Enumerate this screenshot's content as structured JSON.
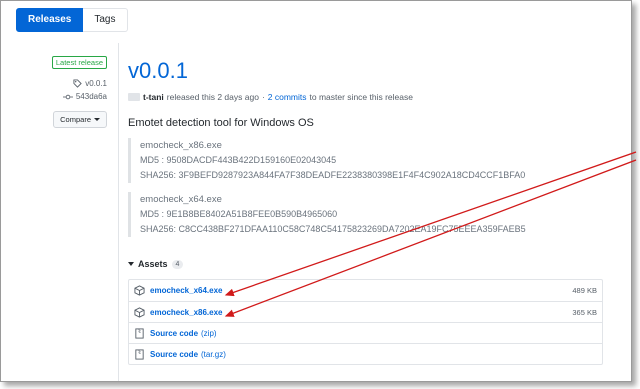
{
  "tabs": {
    "releases": "Releases",
    "tags": "Tags"
  },
  "sidebar": {
    "badge": "Latest release",
    "tag": "v0.0.1",
    "commit": "543da6a",
    "compare": "Compare"
  },
  "release": {
    "title": "v0.0.1",
    "author": "t-tani",
    "released": "released this 2 days ago",
    "separator": "·",
    "commits_link": "2 commits",
    "commits_suffix": "to master since this release",
    "description": "Emotet detection tool for Windows OS",
    "files": [
      {
        "name": "emocheck_x86.exe",
        "md5": "MD5 : 9508DACDF443B422D159160E02043045",
        "sha256": "SHA256: 3F9BEFD9287923A844FA7F38DEADFE2238380398E1F4F4C902A18CD4CCF1BFA0"
      },
      {
        "name": "emocheck_x64.exe",
        "md5": "MD5 : 9E1B8BE8402A51B8FEE0B590B4965060",
        "sha256": "SHA256: C8CC438BF271DFAA110C58C748C54175823269DA7202EA19FC75EEEA359FAEB5"
      }
    ]
  },
  "assets": {
    "label": "Assets",
    "count": "4",
    "items": [
      {
        "name": "emocheck_x64.exe",
        "size": "489 KB",
        "icon": "package-icon"
      },
      {
        "name": "emocheck_x86.exe",
        "size": "365 KB",
        "icon": "package-icon"
      }
    ],
    "source": [
      {
        "label": "Source code",
        "format": "(zip)",
        "icon": "file-zip-icon"
      },
      {
        "label": "Source code",
        "format": "(tar.gz)",
        "icon": "file-zip-icon"
      }
    ]
  },
  "colors": {
    "link": "#0366d6",
    "badge": "#28a745",
    "arrow": "#d11a1a"
  }
}
